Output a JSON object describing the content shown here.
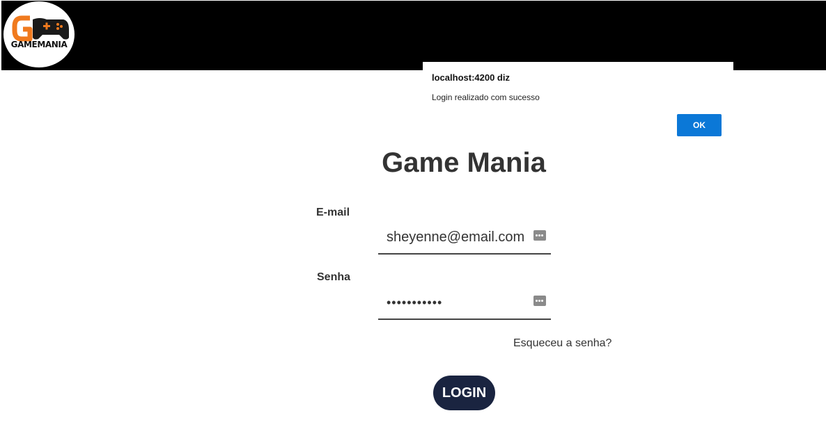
{
  "header": {
    "logo_text": "GAMEMANIA",
    "logo_initials": "GM"
  },
  "dialog": {
    "title": "localhost:4200 diz",
    "message": "Login realizado com sucesso",
    "ok_label": "OK",
    "ok_color": "#0b78d7"
  },
  "login": {
    "title": "Game Mania",
    "email_label": "E-mail",
    "email_value": "sheyenne@email.com",
    "password_label": "Senha",
    "password_value": "sheyenne123",
    "password_key_icon": "password-manager-key-icon",
    "forgot_label": "Esqueceu a senha?",
    "submit_label": "LOGIN",
    "submit_color": "#1a2440"
  }
}
